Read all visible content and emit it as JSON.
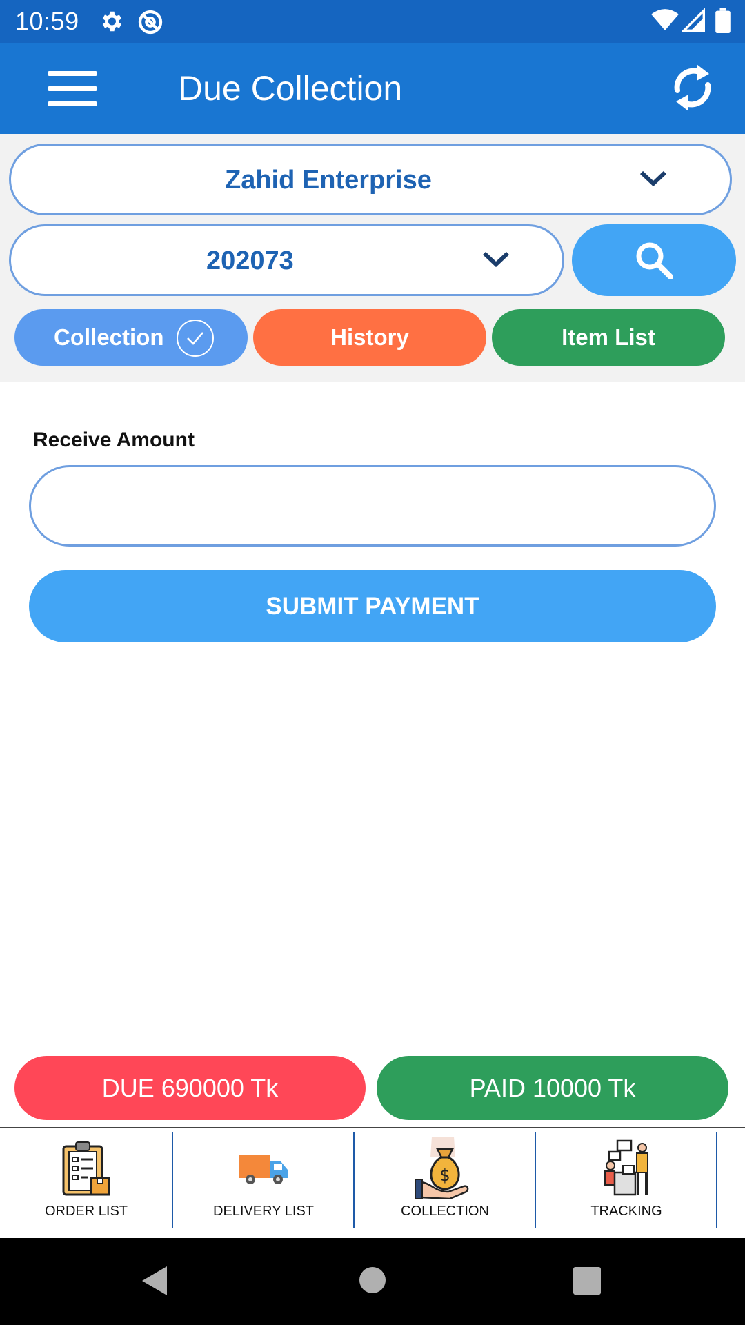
{
  "status_bar": {
    "time": "10:59"
  },
  "app_bar": {
    "title": "Due Collection"
  },
  "filters": {
    "shop_select": "Zahid Enterprise",
    "order_select": "202073"
  },
  "tabs": [
    {
      "label": "Collection",
      "active": true
    },
    {
      "label": "History"
    },
    {
      "label": "Item List"
    }
  ],
  "form": {
    "receive_label": "Receive Amount",
    "receive_value": "",
    "submit_label": "SUBMIT PAYMENT"
  },
  "summary": {
    "due": "DUE  690000 Tk",
    "paid": "PAID  10000 Tk"
  },
  "bottom_nav": [
    {
      "label": "ORDER LIST",
      "icon": "clipboard-box-icon"
    },
    {
      "label": "DELIVERY LIST",
      "icon": "delivery-truck-icon"
    },
    {
      "label": "COLLECTION",
      "icon": "money-bag-icon"
    },
    {
      "label": "TRACKING",
      "icon": "tracking-people-icon"
    }
  ],
  "colors": {
    "primary": "#1976d2",
    "status_bar": "#1565c0",
    "accent_blue": "#42a5f5",
    "history": "#ff7043",
    "green": "#2e9e5b",
    "due_red": "#ff4757"
  }
}
